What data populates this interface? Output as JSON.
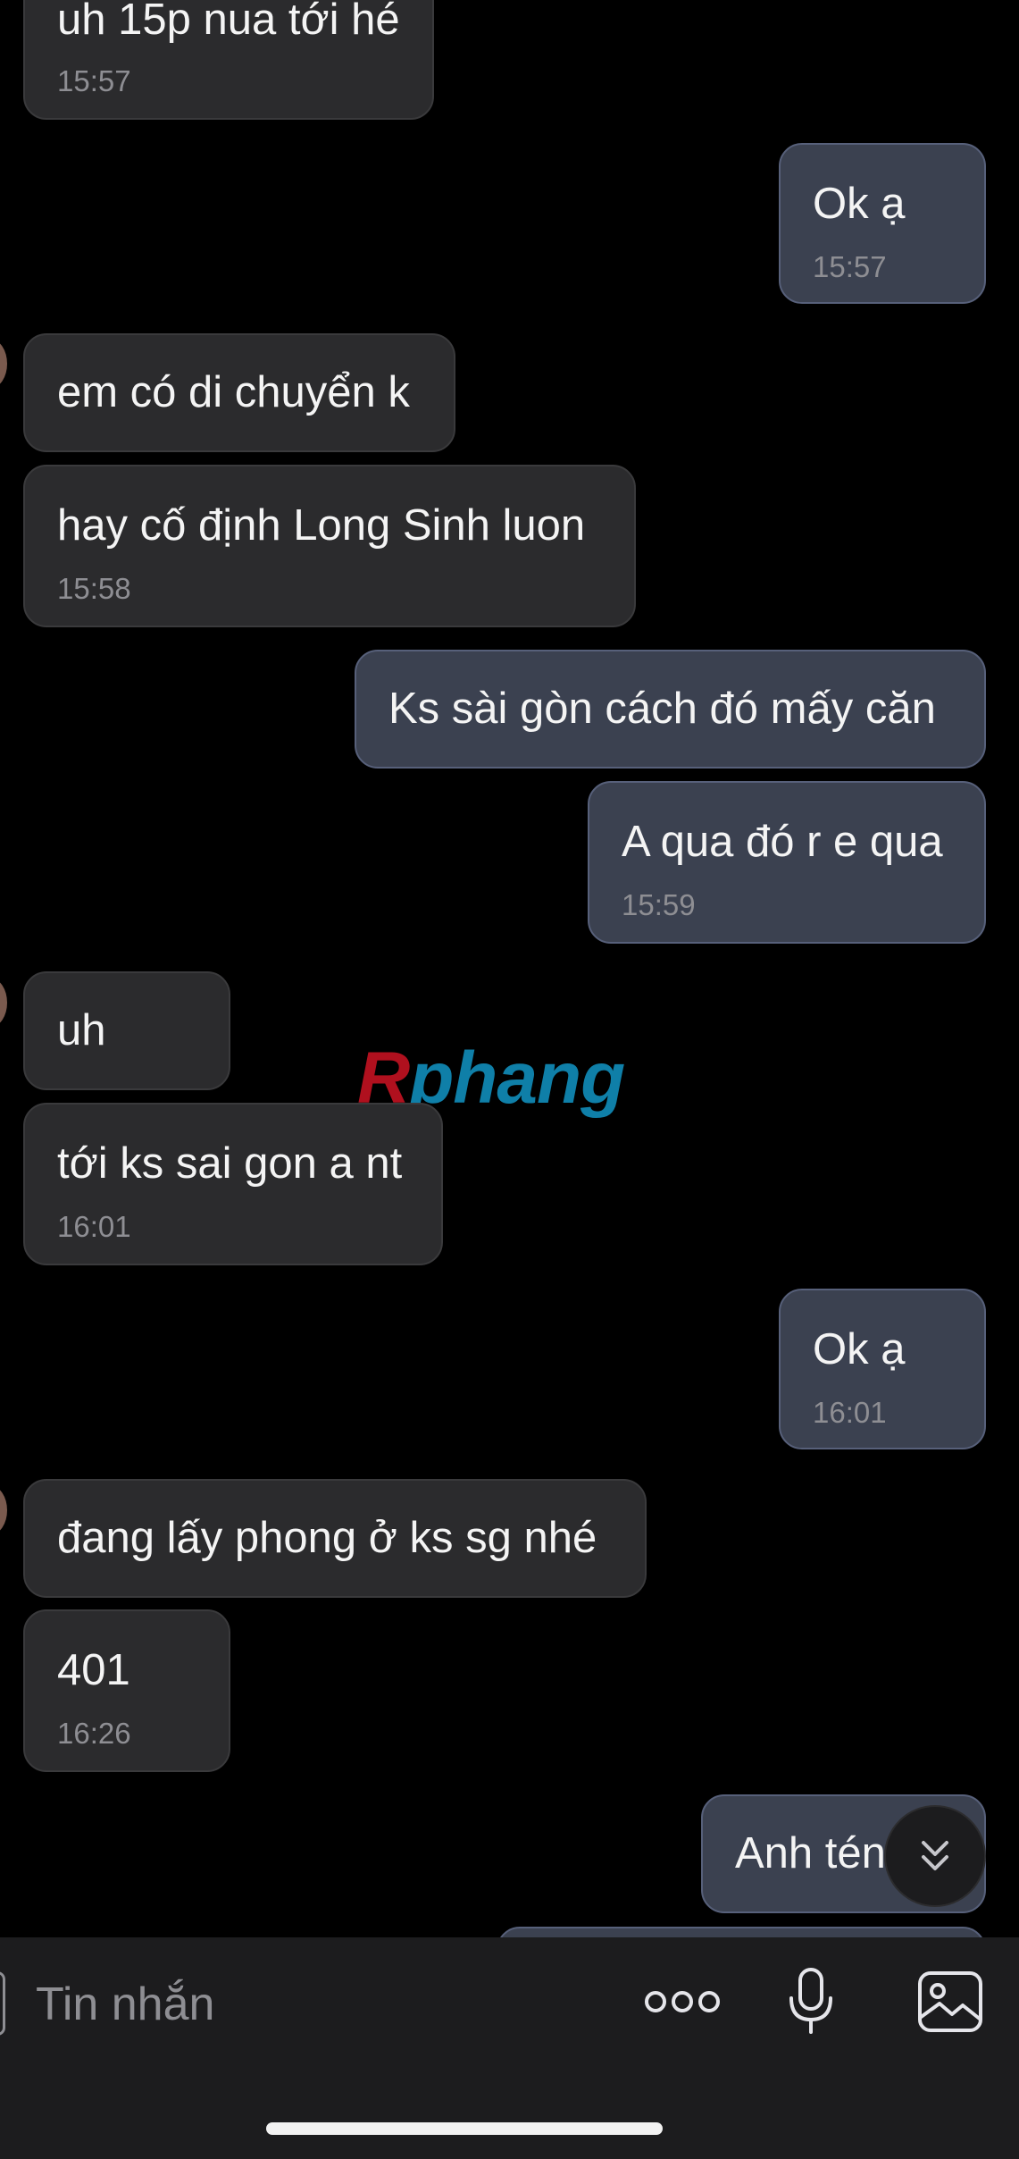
{
  "messages": [
    {
      "dir": "in",
      "text": "uh 15p nua tới hé",
      "time": "15:57"
    },
    {
      "dir": "out",
      "text": "Ok ạ",
      "time": "15:57"
    },
    {
      "dir": "in",
      "text": "em có di chuyển k",
      "time": ""
    },
    {
      "dir": "in",
      "text": "hay cố định Long Sinh luon",
      "time": "15:58"
    },
    {
      "dir": "out",
      "text": "Ks sài gòn cách đó mấy căn",
      "time": ""
    },
    {
      "dir": "out",
      "text": "A qua đó r e qua",
      "time": "15:59"
    },
    {
      "dir": "in",
      "text": "uh",
      "time": ""
    },
    {
      "dir": "in",
      "text": "tới ks sai gon a nt",
      "time": "16:01"
    },
    {
      "dir": "out",
      "text": "Ok ạ",
      "time": "16:01"
    },
    {
      "dir": "in",
      "text": "đang lấy phong ở ks sg nhé",
      "time": ""
    },
    {
      "dir": "in",
      "text": "401",
      "time": "16:26"
    },
    {
      "dir": "out",
      "text": "Anh tén",
      "time": ""
    }
  ],
  "watermark": {
    "first": "R",
    "rest": "phang"
  },
  "composer": {
    "placeholder": "Tin nhắn",
    "icons": [
      "more-icon",
      "microphone-icon",
      "image-icon"
    ]
  },
  "scroll_button": {
    "icon": "chevron-double-down-icon"
  },
  "colors": {
    "background": "#000000",
    "incoming_bubble": "#2b2b2d",
    "outgoing_bubble": "#3b4150",
    "outgoing_border": "#57607a",
    "timestamp": "#8e8e93"
  }
}
